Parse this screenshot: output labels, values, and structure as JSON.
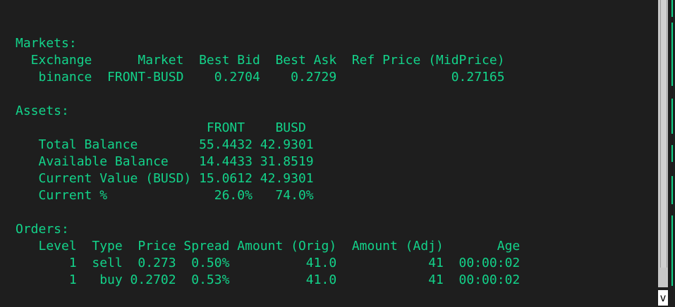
{
  "terminal": {
    "lines": [
      "Markets:",
      "  Exchange      Market  Best Bid  Best Ask  Ref Price (MidPrice)",
      "   binance  FRONT-BUSD    0.2704    0.2729               0.27165",
      "",
      "Assets:",
      "                         FRONT    BUSD",
      "   Total Balance        55.4432 42.9301",
      "   Available Balance    14.4433 31.8519",
      "   Current Value (BUSD) 15.0612 42.9301",
      "   Current %              26.0%   74.0%",
      "",
      "Orders:",
      "   Level  Type  Price Spread Amount (Orig)  Amount (Adj)       Age",
      "       1  sell  0.273  0.50%          41.0            41  00:00:02",
      "       1   buy 0.2702  0.53%          41.0            41  00:00:02"
    ]
  },
  "scroll_indicator": "v",
  "colors": {
    "background": "#1e1e1e",
    "text": "#13d38a",
    "scrollbar": "#c8c8c8"
  }
}
